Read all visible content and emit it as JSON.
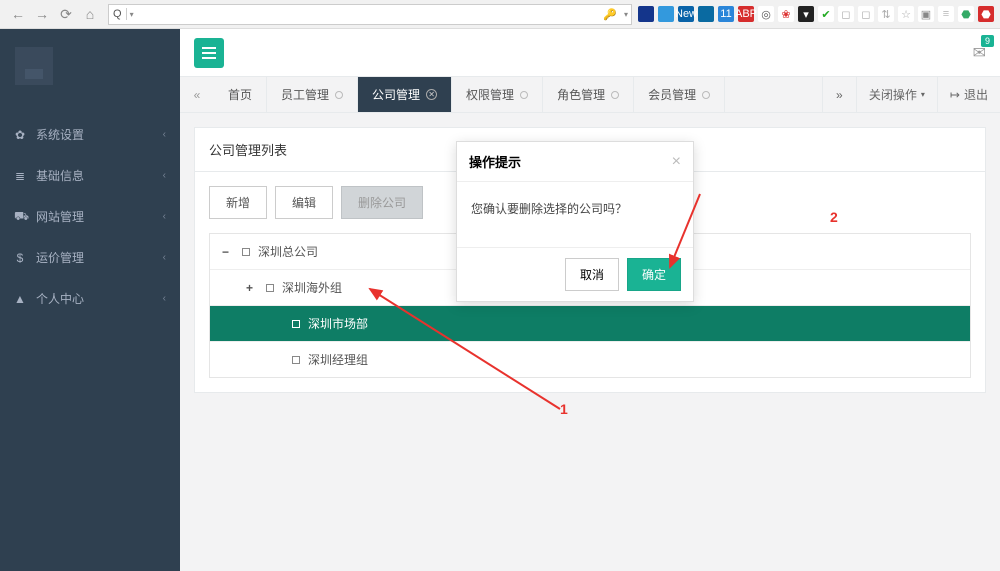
{
  "browser": {
    "proto": "Q",
    "url": "",
    "ext_icons": [
      {
        "bg": "#14358b",
        "fg": "#fff",
        "txt": ""
      },
      {
        "bg": "#3399dd",
        "fg": "#fff",
        "txt": ""
      },
      {
        "bg": "#0963a8",
        "fg": "#fff",
        "txt": "New"
      },
      {
        "bg": "#0a6aa1",
        "fg": "#fff",
        "txt": ""
      },
      {
        "bg": "#2b86d9",
        "fg": "#fff",
        "txt": "11"
      },
      {
        "bg": "#d62d2d",
        "fg": "#fff",
        "txt": "ABP"
      },
      {
        "bg": "#fff",
        "fg": "#555",
        "txt": "◎"
      },
      {
        "bg": "#fff",
        "fg": "#d33",
        "txt": "❀"
      },
      {
        "bg": "#222",
        "fg": "#fff",
        "txt": "▾"
      },
      {
        "bg": "#fff",
        "fg": "#2a2",
        "txt": "✔"
      },
      {
        "bg": "#fff",
        "fg": "#aaa",
        "txt": "◻"
      },
      {
        "bg": "#fff",
        "fg": "#aaa",
        "txt": "◻"
      },
      {
        "bg": "#fff",
        "fg": "#aaa",
        "txt": "⇅"
      },
      {
        "bg": "#fff",
        "fg": "#aaa",
        "txt": "☆"
      },
      {
        "bg": "#fff",
        "fg": "#888",
        "txt": "▣"
      },
      {
        "bg": "#fff",
        "fg": "#bbb",
        "txt": "≡"
      },
      {
        "bg": "#fff",
        "fg": "#3a6",
        "txt": "⬣"
      },
      {
        "bg": "#d62d2d",
        "fg": "#fff",
        "txt": "⬣"
      }
    ]
  },
  "header": {
    "msg_count": "9"
  },
  "sidebar": {
    "items": [
      {
        "icon": "✿",
        "label": "系统设置"
      },
      {
        "icon": "≣",
        "label": "基础信息"
      },
      {
        "icon": "⛟",
        "label": "网站管理"
      },
      {
        "icon": "$",
        "label": "运价管理"
      },
      {
        "icon": "▲",
        "label": "个人中心"
      }
    ]
  },
  "tabs": {
    "items": [
      {
        "label": "首页",
        "active": false,
        "closable": false
      },
      {
        "label": "员工管理",
        "active": false,
        "closable": true
      },
      {
        "label": "公司管理",
        "active": true,
        "closable": true
      },
      {
        "label": "权限管理",
        "active": false,
        "closable": true
      },
      {
        "label": "角色管理",
        "active": false,
        "closable": true
      },
      {
        "label": "会员管理",
        "active": false,
        "closable": true
      }
    ],
    "close_op": "关闭操作",
    "logout": "退出"
  },
  "panel": {
    "title": "公司管理列表",
    "buttons": {
      "add": "新增",
      "edit": "编辑",
      "del": "删除公司"
    }
  },
  "tree": [
    {
      "lvl": 0,
      "toggle": "−",
      "label": "深圳总公司",
      "sel": false
    },
    {
      "lvl": 1,
      "toggle": "+",
      "label": "深圳海外组",
      "sel": false
    },
    {
      "lvl": 2,
      "toggle": "",
      "label": "深圳市场部",
      "sel": true
    },
    {
      "lvl": 2,
      "toggle": "",
      "label": "深圳经理组",
      "sel": false
    }
  ],
  "modal": {
    "title": "操作提示",
    "body": "您确认要删除选择的公司吗？",
    "cancel": "取消",
    "ok": "确定"
  },
  "annot": {
    "one": "1",
    "two": "2"
  }
}
